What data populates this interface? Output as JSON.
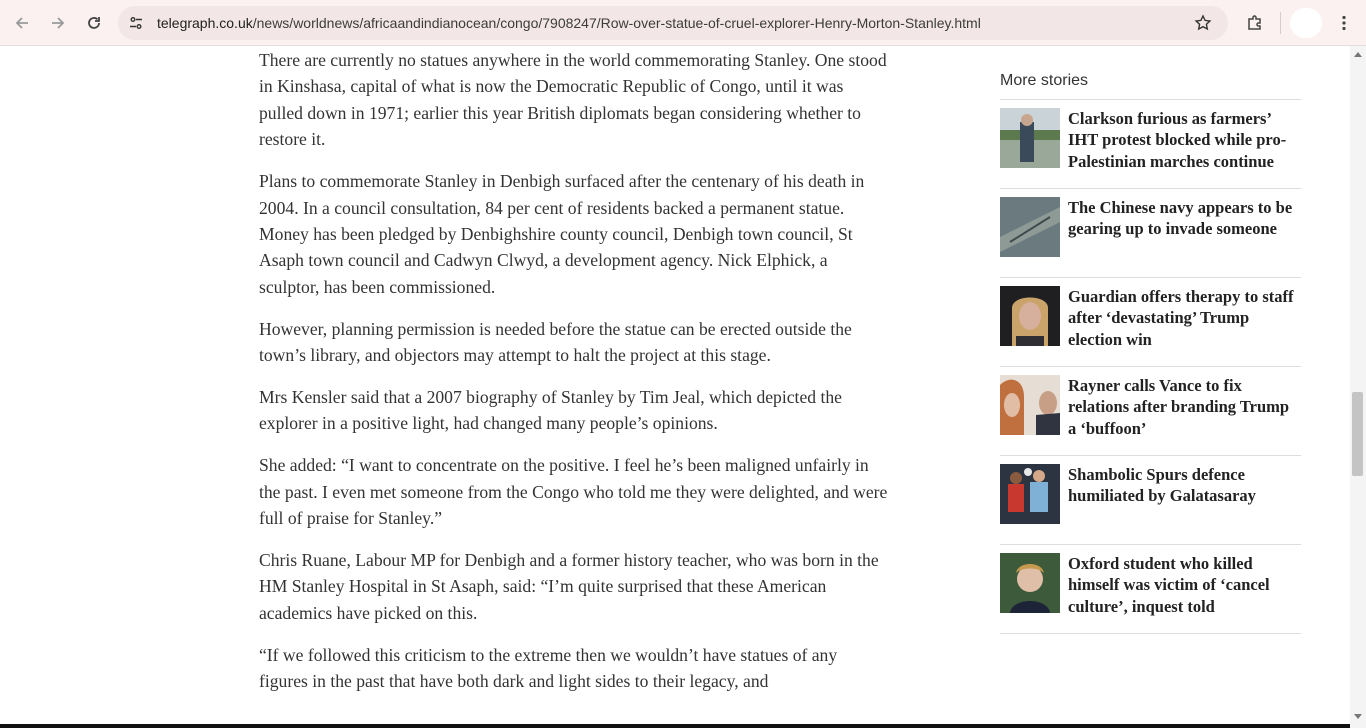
{
  "browser": {
    "url_host": "telegraph.co.uk",
    "url_path": "/news/worldnews/africaandindianocean/congo/7908247/Row-over-statue-of-cruel-explorer-Henry-Morton-Stanley.html",
    "icons": [
      "back-icon",
      "forward-icon",
      "reload-icon",
      "site-info-icon",
      "bookmark-star-icon",
      "extensions-icon",
      "menu-icon"
    ]
  },
  "article": {
    "paragraphs": [
      "There are currently no statues anywhere in the world commemorating Stanley. One stood in Kinshasa, capital of what is now the Democratic Republic of Congo, until it was pulled down in 1971; earlier this year British diplomats began considering whether to restore it.",
      "Plans to commemorate Stanley in Denbigh surfaced after the centenary of his death in 2004. In a council consultation, 84 per cent of residents backed a permanent statue. Money has been pledged by Denbighshire county council, Denbigh town council, St Asaph town council and Cadwyn Clwyd, a development agency. Nick Elphick, a sculptor, has been commissioned.",
      "However, planning permission is needed before the statue can be erected outside the town’s library, and objectors may attempt to halt the project at this stage.",
      "Mrs Kensler said that a 2007 biography of Stanley by Tim Jeal, which depicted the explorer in a positive light, had changed many people’s opinions.",
      "She added: “I want to concentrate on the positive. I feel he’s been maligned unfairly in the past. I even met someone from the Congo who told me they were delighted, and were full of praise for Stanley.”",
      "Chris Ruane, Labour MP for Denbigh and a former history teacher, who was born in the HM Stanley Hospital in St Asaph, said: “I’m quite surprised that these American academics have picked on this.",
      "“If we followed this criticism to the extreme then we wouldn’t have statues of any figures in the past that have both dark and light sides to their legacy, and"
    ]
  },
  "sidebar": {
    "heading": "More stories",
    "stories": [
      {
        "title": "Clarkson furious as farmers’ IHT protest blocked while pro-Palestinian marches continue"
      },
      {
        "title": "The Chinese navy appears to be gearing up to invade someone"
      },
      {
        "title": "Guardian offers therapy to staff after ‘devastating’ Trump election win"
      },
      {
        "title": "Rayner calls Vance to fix relations after branding Trump a ‘buffoon’"
      },
      {
        "title": "Shambolic Spurs defence humiliated by Galatasaray"
      },
      {
        "title": "Oxford student who killed himself was victim of ‘cancel culture’, inquest told"
      }
    ]
  }
}
